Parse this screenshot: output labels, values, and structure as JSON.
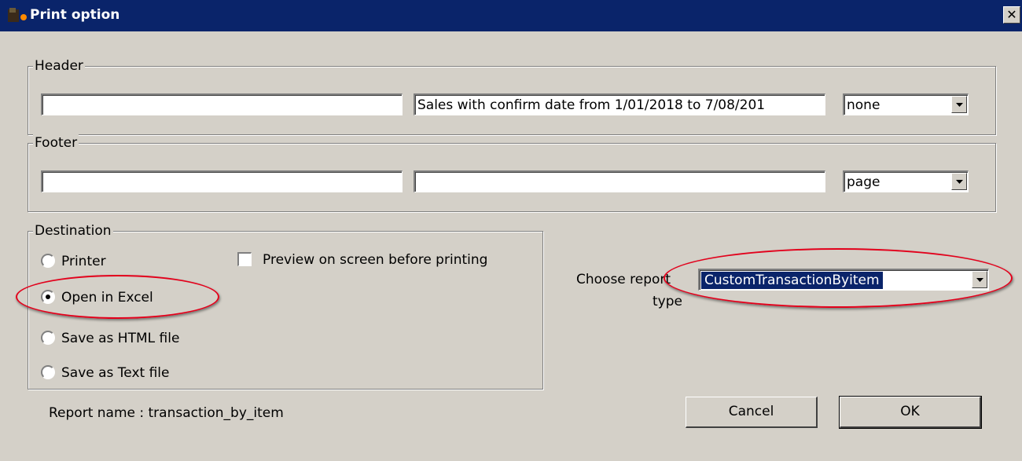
{
  "window": {
    "title": "Print option",
    "close_glyph": "✕",
    "title_bar_color": "#0a246a",
    "background_color": "#d4d0c8"
  },
  "header_group": {
    "label": "Header",
    "left_value": "",
    "center_value": "Sales with confirm date from 1/01/2018 to 7/08/201",
    "right_select": "none"
  },
  "footer_group": {
    "label": "Footer",
    "left_value": "",
    "center_value": "",
    "right_select": "page"
  },
  "destination": {
    "label": "Destination",
    "options": [
      {
        "label": "Printer",
        "checked": false
      },
      {
        "label": "Open in Excel",
        "checked": true
      },
      {
        "label": "Save as HTML file",
        "checked": false
      },
      {
        "label": "Save as Text file",
        "checked": false
      }
    ],
    "preview_checkbox_label": "Preview on screen before printing",
    "preview_checked": false
  },
  "report_type": {
    "label_line1": "Choose report",
    "label_line2": "type",
    "selected": "CustomTransactionByitem"
  },
  "report_name": "Report name :  transaction_by_item",
  "buttons": {
    "cancel": "Cancel",
    "ok": "OK"
  },
  "annotation_color": "#e3001b",
  "icons": {
    "app": "app-logo-icon",
    "close": "close-icon",
    "dropdown": "chevron-down-icon"
  }
}
